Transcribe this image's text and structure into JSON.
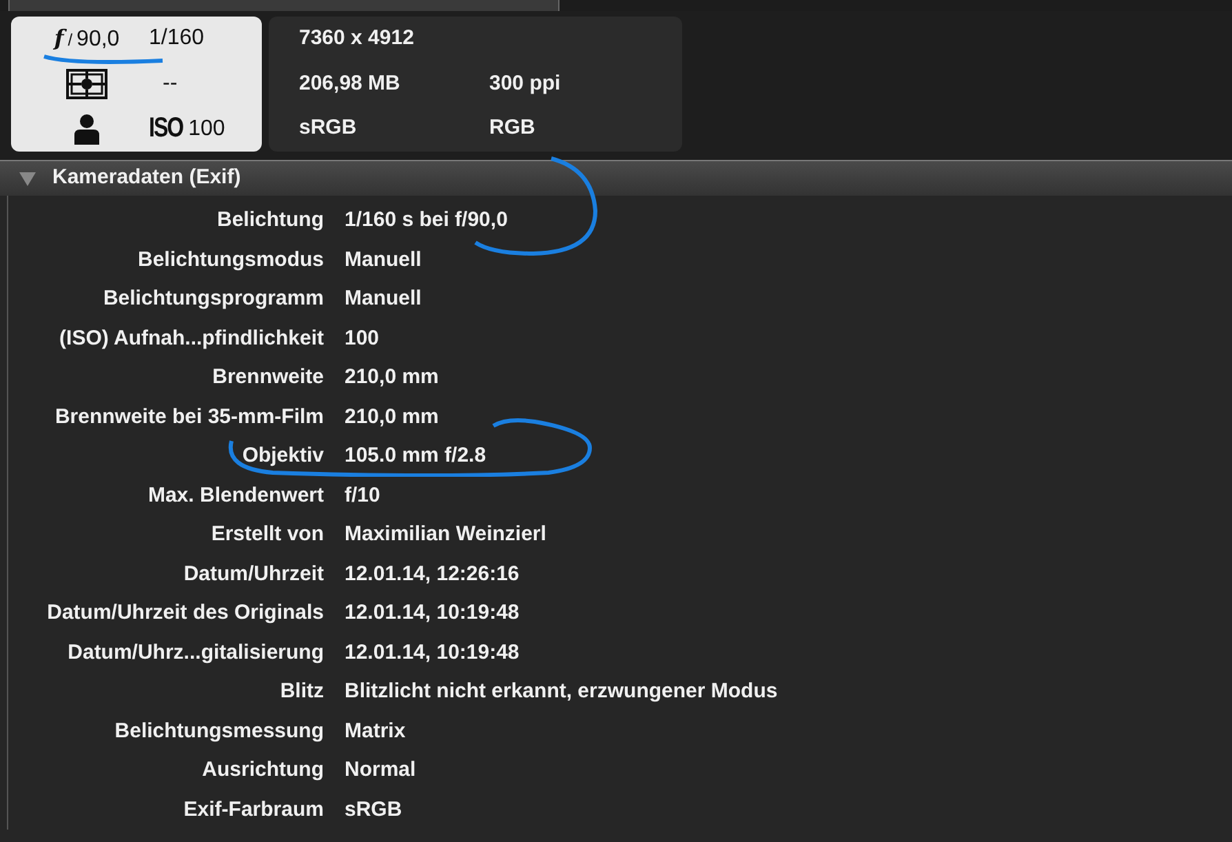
{
  "summary": {
    "aperture_symbol": "f",
    "aperture_slash": "/",
    "aperture": "90,0",
    "shutter": "1/160",
    "metering": "--",
    "iso_label": "ISO",
    "iso": "100",
    "dimensions": "7360 x 4912",
    "size": "206,98 MB",
    "resolution": "300 ppi",
    "profile": "sRGB",
    "mode": "RGB"
  },
  "section": {
    "title": "Kameradaten (Exif)",
    "expanded": true
  },
  "rows": [
    {
      "label": "Belichtung",
      "value": "1/160 s bei f/90,0"
    },
    {
      "label": "Belichtungsmodus",
      "value": "Manuell"
    },
    {
      "label": "Belichtungsprogramm",
      "value": "Manuell"
    },
    {
      "label": "(ISO) Aufnah...pfindlichkeit",
      "value": "100"
    },
    {
      "label": "Brennweite",
      "value": "210,0 mm"
    },
    {
      "label": "Brennweite bei 35-mm-Film",
      "value": "210,0 mm"
    },
    {
      "label": "Objektiv",
      "value": "105.0 mm f/2.8"
    },
    {
      "label": "Max. Blendenwert",
      "value": "f/10"
    },
    {
      "label": "Erstellt von",
      "value": "Maximilian Weinzierl"
    },
    {
      "label": "Datum/Uhrzeit",
      "value": "12.01.14, 12:26:16"
    },
    {
      "label": "Datum/Uhrzeit des Originals",
      "value": "12.01.14, 10:19:48"
    },
    {
      "label": "Datum/Uhrz...gitalisierung",
      "value": "12.01.14, 10:19:48"
    },
    {
      "label": "Blitz",
      "value": "Blitzlicht nicht erkannt, erzwungener Modus"
    },
    {
      "label": "Belichtungsmessung",
      "value": "Matrix"
    },
    {
      "label": "Ausrichtung",
      "value": "Normal"
    },
    {
      "label": "Exif-Farbraum",
      "value": "sRGB"
    }
  ]
}
